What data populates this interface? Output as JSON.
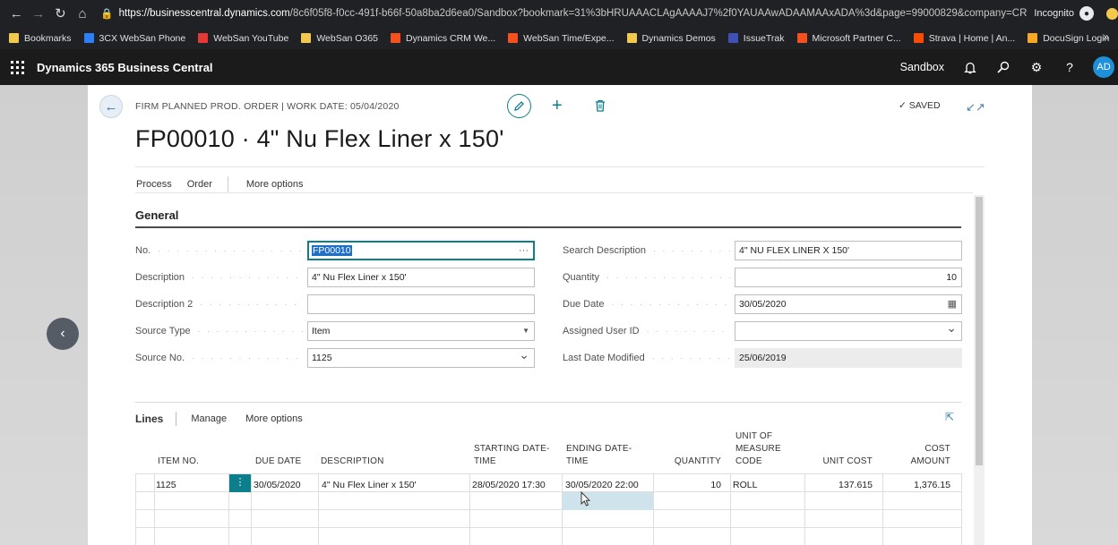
{
  "browser": {
    "url_host": "https://businesscentral.dynamics.com",
    "url_path": "/8c6f05f8-f0cc-491f-b66f-50a8ba2d6ea0/Sandbox?bookmark=31%3bHRUAAACLAgAAAAJ7%2f0YAUAAwADAAMAAxADA%3d&page=99000829&company=CRO...",
    "incognito_label": "Incognito",
    "bookmarks": [
      {
        "label": "Bookmarks",
        "color": "#f2c94c"
      },
      {
        "label": "3CX WebSan Phone",
        "color": "#2d7ff9"
      },
      {
        "label": "WebSan YouTube",
        "color": "#e53935"
      },
      {
        "label": "WebSan O365",
        "color": "#f2c94c"
      },
      {
        "label": "Dynamics CRM We...",
        "color": "#f4511e"
      },
      {
        "label": "WebSan Time/Expe...",
        "color": "#f4511e"
      },
      {
        "label": "Dynamics Demos",
        "color": "#f2c94c"
      },
      {
        "label": "IssueTrak",
        "color": "#3f51b5"
      },
      {
        "label": "Microsoft Partner C...",
        "color": "#f4511e"
      },
      {
        "label": "Strava | Home | An...",
        "color": "#fc4c02"
      },
      {
        "label": "DocuSign Login",
        "color": "#f9a825"
      }
    ],
    "bookmarks_more": "»"
  },
  "app": {
    "name": "Dynamics 365 Business Central",
    "environment": "Sandbox",
    "user_initials": "AD",
    "accent": "#0d7e8c"
  },
  "page": {
    "breadcrumb": "FIRM PLANNED PROD. ORDER | WORK DATE: 05/04/2020",
    "status": "SAVED",
    "title": "FP00010 · 4\" Nu Flex Liner x 150'",
    "actions": [
      "Process",
      "Order",
      "More options"
    ]
  },
  "general": {
    "title": "General",
    "left": [
      {
        "label": "No.",
        "value": "FP00010",
        "type": "lookup"
      },
      {
        "label": "Description",
        "value": "4\" Nu Flex Liner x 150'",
        "type": "text"
      },
      {
        "label": "Description 2",
        "value": "",
        "type": "text"
      },
      {
        "label": "Source Type",
        "value": "Item",
        "type": "select"
      },
      {
        "label": "Source No.",
        "value": "1125",
        "type": "dropdown"
      }
    ],
    "right": [
      {
        "label": "Search Description",
        "value": "4\" NU FLEX LINER X 150'",
        "type": "text"
      },
      {
        "label": "Quantity",
        "value": "10",
        "type": "number"
      },
      {
        "label": "Due Date",
        "value": "30/05/2020",
        "type": "date"
      },
      {
        "label": "Assigned User ID",
        "value": "",
        "type": "dropdown"
      },
      {
        "label": "Last Date Modified",
        "value": "25/06/2019",
        "type": "readonly"
      }
    ]
  },
  "lines": {
    "title": "Lines",
    "actions": [
      "Manage",
      "More options"
    ],
    "columns": [
      {
        "key": "item_no",
        "label": "ITEM NO."
      },
      {
        "key": "due_date",
        "label": "DUE DATE"
      },
      {
        "key": "description",
        "label": "DESCRIPTION"
      },
      {
        "key": "starting",
        "label": "STARTING DATE-TIME"
      },
      {
        "key": "ending",
        "label": "ENDING DATE-TIME"
      },
      {
        "key": "quantity",
        "label": "QUANTITY"
      },
      {
        "key": "uom",
        "label": "UNIT OF MEASURE CODE"
      },
      {
        "key": "unit_cost",
        "label": "UNIT COST"
      },
      {
        "key": "cost_amount",
        "label": "COST AMOUNT"
      }
    ],
    "rows": [
      {
        "item_no": "1125",
        "due_date": "30/05/2020",
        "description": "4\" Nu Flex Liner x 150'",
        "starting": "28/05/2020 17:30",
        "ending": "30/05/2020 22:00",
        "quantity": "10",
        "uom": "ROLL",
        "unit_cost": "137.615",
        "cost_amount": "1,376.15"
      }
    ],
    "row_menu_glyph": "⋮"
  }
}
